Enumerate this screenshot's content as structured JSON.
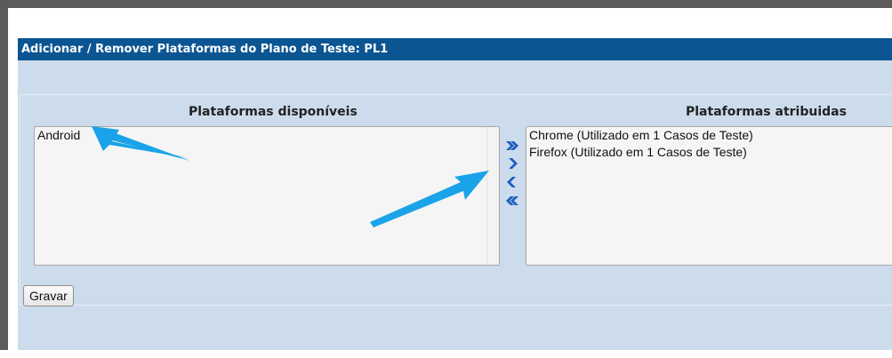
{
  "header": {
    "title": "Adicionar / Remover Plataformas do Plano de Teste: PL1"
  },
  "available": {
    "heading": "Plataformas disponíveis",
    "options": [
      "Android"
    ]
  },
  "assigned": {
    "heading": "Plataformas atribuidas",
    "options": [
      "Chrome (Utilizado em 1 Casos de Teste)",
      "Firefox (Utilizado em 1 Casos de Teste)"
    ]
  },
  "movers": {
    "add_all_icon": "double-chevron-right-icon",
    "add_icon": "chevron-right-icon",
    "remove_icon": "chevron-left-icon",
    "remove_all_icon": "double-chevron-left-icon"
  },
  "actions": {
    "save_label": "Gravar"
  },
  "colors": {
    "title_bar": "#0b5592",
    "background": "#cddcec",
    "annotation_arrow": "#1aa3e8",
    "mover_icon": "#1e5fbf"
  }
}
